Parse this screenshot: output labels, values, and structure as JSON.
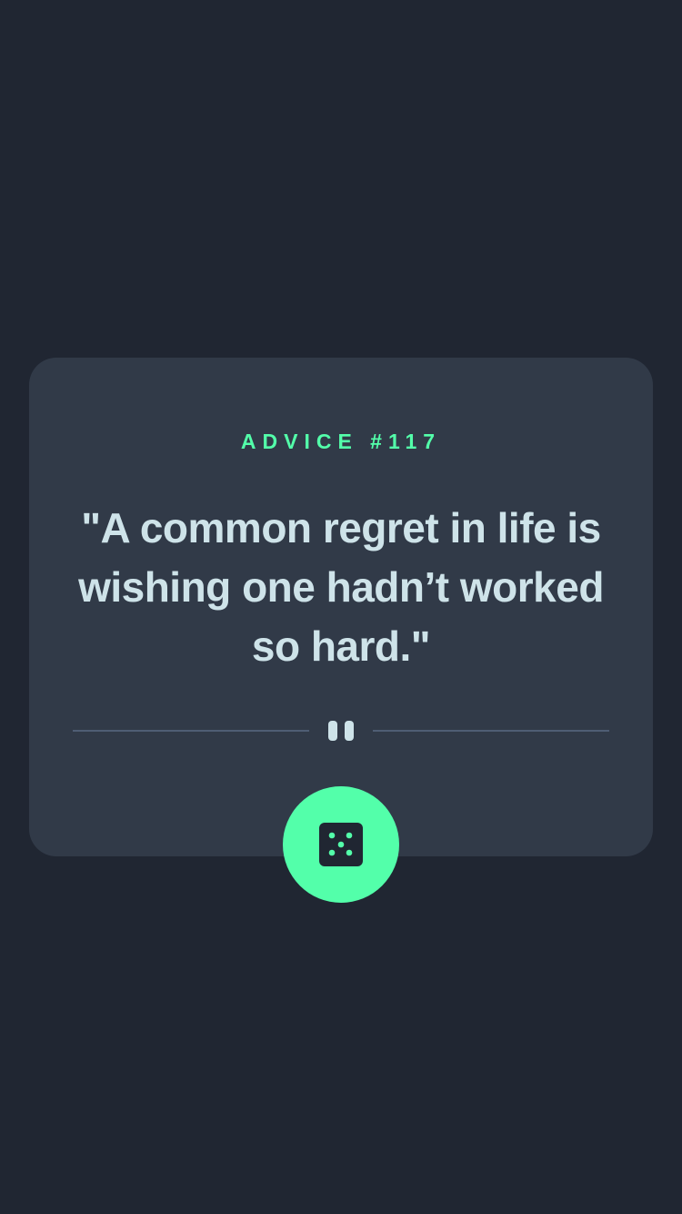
{
  "advice": {
    "label": "ADVICE #117",
    "quote": "\"A common regret in life is wishing one hadn’t worked so hard.\""
  },
  "divider": {
    "icon": "pause-icon"
  },
  "generate_button": {
    "icon": "dice-icon"
  },
  "colors": {
    "background": "#202632",
    "card": "#313A48",
    "accent": "#53FFAA",
    "text": "#CEE3E9",
    "divider": "#4F5D74"
  }
}
